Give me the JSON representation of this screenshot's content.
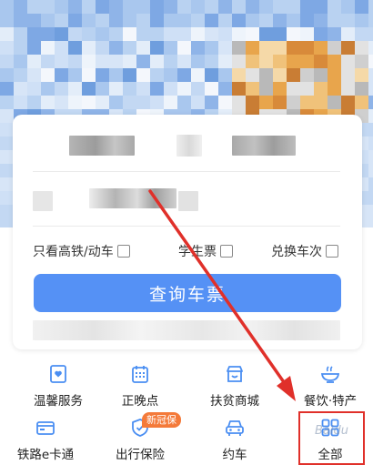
{
  "options": {
    "high_speed_only": "只看高铁/动车",
    "student_ticket": "学生票",
    "exchange_train": "兑换车次"
  },
  "query_button": "查询车票",
  "services": [
    {
      "label": "温馨服务",
      "icon": "heart-card-icon"
    },
    {
      "label": "正晚点",
      "icon": "calendar-grid-icon"
    },
    {
      "label": "扶贫商城",
      "icon": "shop-icon"
    },
    {
      "label": "餐饮·特产",
      "icon": "bowl-icon"
    },
    {
      "label": "铁路e卡通",
      "icon": "card-icon"
    },
    {
      "label": "出行保险",
      "icon": "shield-icon"
    },
    {
      "label": "约车",
      "icon": "car-icon"
    },
    {
      "label": "全部",
      "icon": "grid-four-icon"
    }
  ],
  "badge": "新冠保",
  "watermark": "Baidu",
  "colors": {
    "primary": "#5591f5",
    "icon": "#4a8ef2",
    "badge": "#f47a3a",
    "highlight": "#e0302a"
  }
}
